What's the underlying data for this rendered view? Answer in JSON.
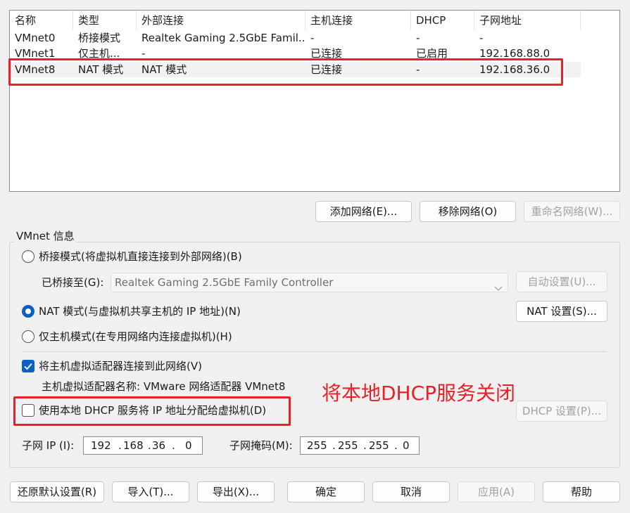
{
  "table": {
    "headers": [
      "名称",
      "类型",
      "外部连接",
      "主机连接",
      "DHCP",
      "子网地址"
    ],
    "rows": [
      [
        "VMnet0",
        "桥接模式",
        "Realtek Gaming 2.5GbE Famil...",
        "-",
        "-",
        "-"
      ],
      [
        "VMnet1",
        "仅主机...",
        "-",
        "已连接",
        "已启用",
        "192.168.88.0"
      ],
      [
        "VMnet8",
        "NAT 模式",
        "NAT 模式",
        "已连接",
        "-",
        "192.168.36.0"
      ]
    ],
    "selected_row": 2
  },
  "table_buttons": {
    "add": "添加网络(E)...",
    "remove": "移除网络(O)",
    "rename": "重命名网络(W)..."
  },
  "vmnet_info": {
    "title": "VMnet 信息",
    "bridge_mode": "桥接模式(将虚拟机直接连接到外部网络)(B)",
    "bridged_to_label": "已桥接至(G):",
    "bridged_to_value": "Realtek Gaming 2.5GbE Family Controller",
    "auto_settings": "自动设置(U)...",
    "nat_mode": "NAT 模式(与虚拟机共享主机的 IP 地址)(N)",
    "nat_settings": "NAT 设置(S)...",
    "host_only_mode": "仅主机模式(在专用网络内连接虚拟机)(H)",
    "connect_adapter": "将主机虚拟适配器连接到此网络(V)",
    "adapter_name": "主机虚拟适配器名称: VMware 网络适配器 VMnet8",
    "use_dhcp": "使用本地 DHCP 服务将 IP 地址分配给虚拟机(D)",
    "dhcp_settings": "DHCP 设置(P)...",
    "subnet_ip_label": "子网 IP (I):",
    "subnet_ip": [
      "192",
      "168",
      "36",
      "0"
    ],
    "subnet_mask_label": "子网掩码(M):",
    "subnet_mask": [
      "255",
      "255",
      "255",
      "0"
    ],
    "selected_mode": "nat",
    "connect_adapter_checked": true,
    "use_dhcp_checked": false
  },
  "annotation": "将本地DHCP服务关闭",
  "bottom_buttons": {
    "restore": "还原默认设置(R)",
    "import": "导入(T)...",
    "export": "导出(X)...",
    "ok": "确定",
    "cancel": "取消",
    "apply": "应用(A)",
    "help": "帮助"
  },
  "colors": {
    "highlight": "#e8202a",
    "accent": "#0a60c2"
  }
}
